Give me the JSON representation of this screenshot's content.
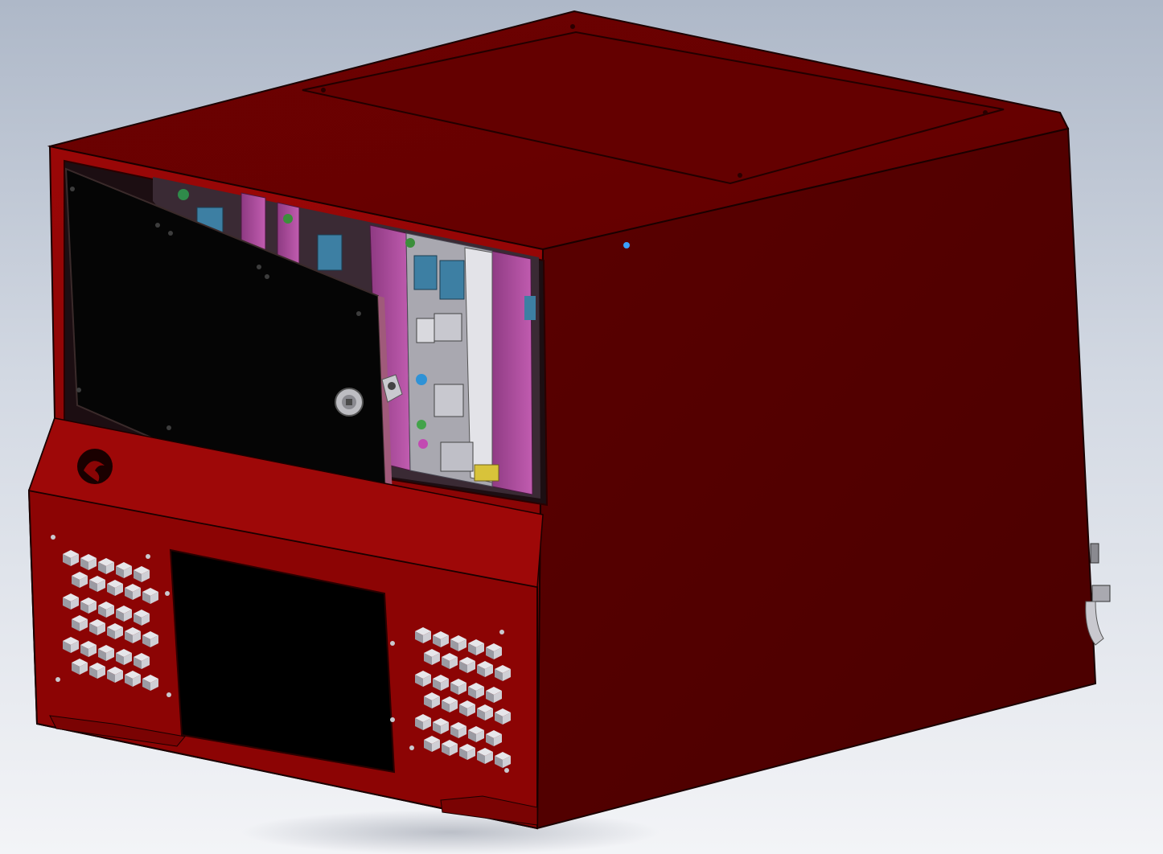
{
  "viewport": {
    "background_top": "#aeb8c8",
    "background_bottom": "#f3f4f7"
  },
  "model": {
    "body_color": "#8a0505",
    "side_color": "#520000",
    "top_color": "#6a0101",
    "edge_color": "#1a0000",
    "door_color": "#050505",
    "card_color": "#b24fa0",
    "card_dark": "#7a2f6f",
    "connector_blue": "#3d7fa3",
    "connector_yellow": "#d8c33a",
    "vent_light": "#e6e6ea",
    "vent_shadow": "#9b9ba3",
    "logo_icon": "dragon-logo-icon",
    "vent_icon": "hex-vent-icon",
    "lock_icon": "keylock-icon",
    "selection_dot_color": "#3aa0ff"
  }
}
